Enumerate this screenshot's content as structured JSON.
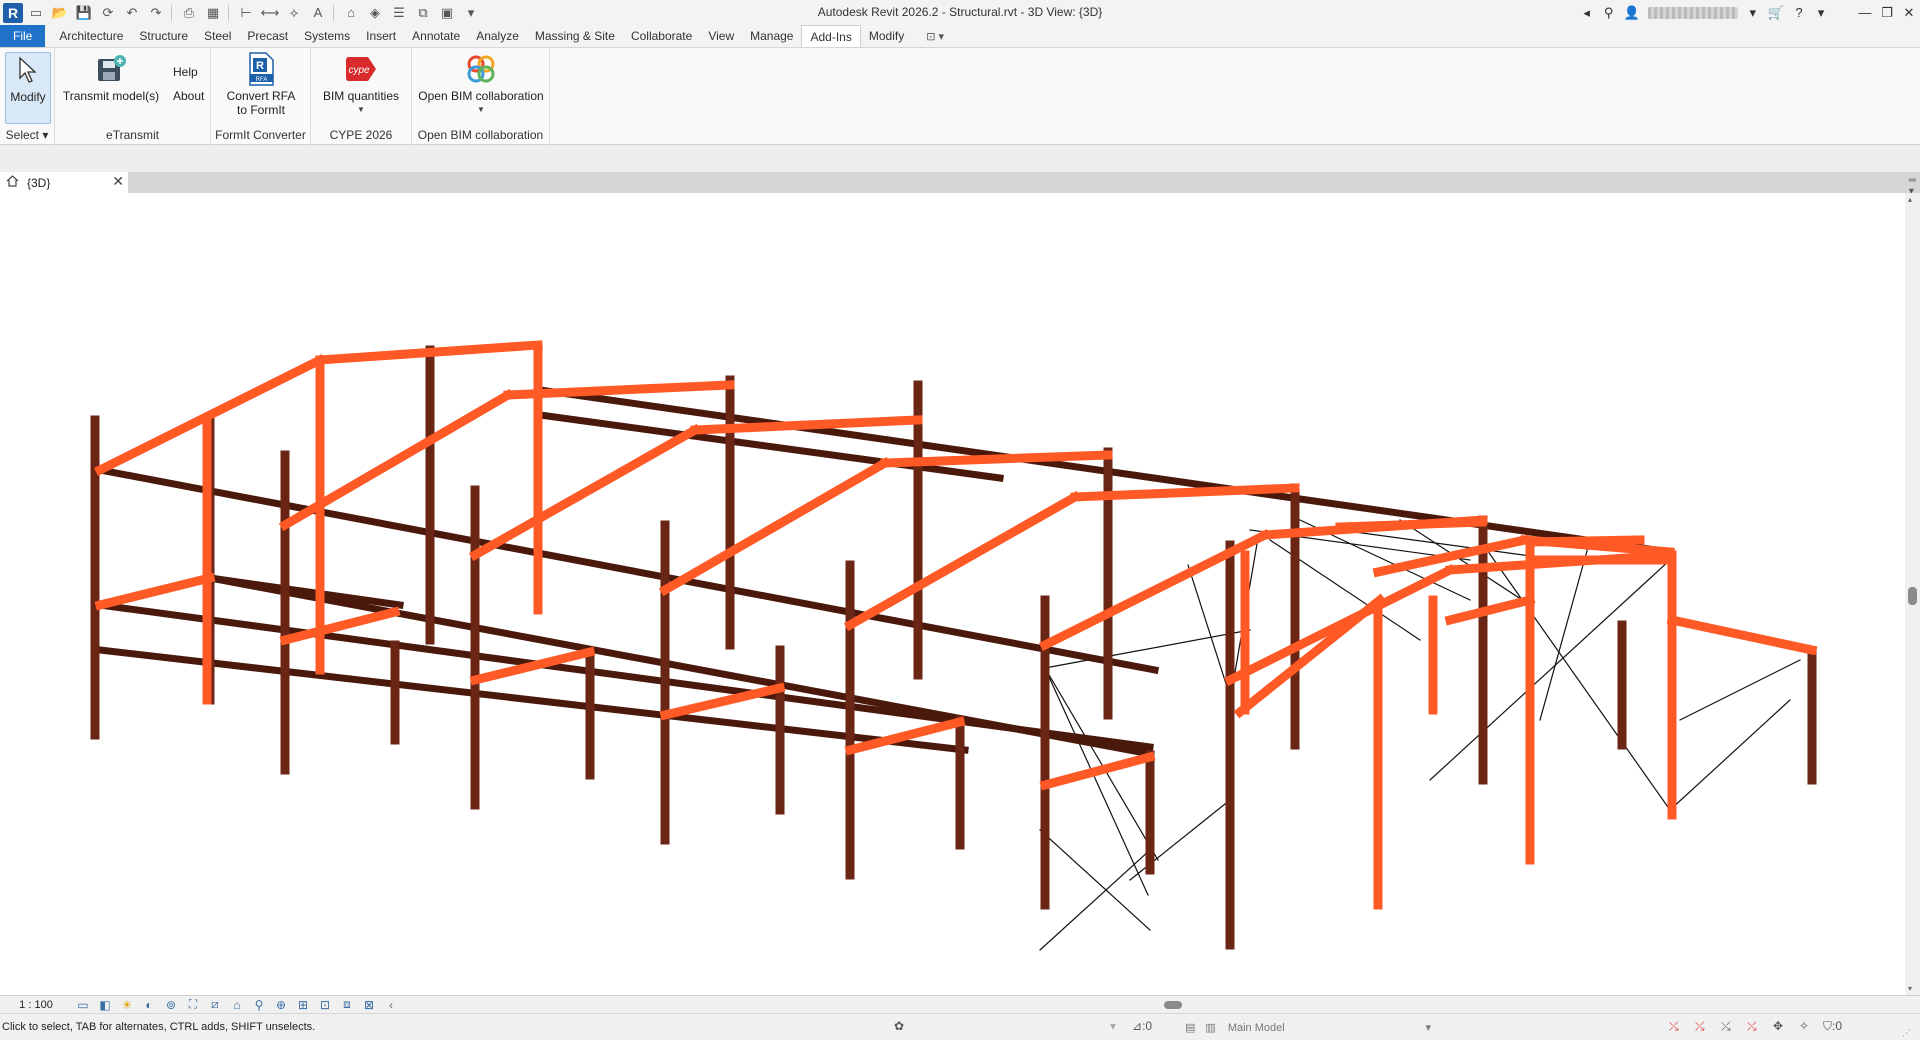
{
  "title_bar": {
    "app_logo": "R",
    "window_title": "Autodesk Revit 2026.2 - Structural.rvt - 3D View: {3D}",
    "qat_icons": [
      "new-icon",
      "open-icon",
      "save-icon",
      "sync-icon",
      "undo-icon",
      "redo-icon",
      "print-icon",
      "schedule-icon",
      "measure-icon",
      "dimension-icon",
      "tag-icon",
      "text-icon",
      "3d-view-icon",
      "section-icon",
      "thin-lines-icon",
      "close-hidden-icon",
      "switch-windows-icon",
      "customize-icon"
    ],
    "right_icons": [
      "search-icon",
      "binoculars-icon",
      "user-icon",
      "cart-icon",
      "help-icon",
      "minimize-icon",
      "restore-icon",
      "close-icon"
    ]
  },
  "ribbon_tabs": [
    "File",
    "Architecture",
    "Structure",
    "Steel",
    "Precast",
    "Systems",
    "Insert",
    "Annotate",
    "Analyze",
    "Massing & Site",
    "Collaborate",
    "View",
    "Manage",
    "Add-Ins",
    "Modify"
  ],
  "active_tab": "Add-Ins",
  "ribbon": {
    "select_panel": {
      "button": "Modify",
      "title": "Select"
    },
    "etransmit_panel": {
      "transmit": "Transmit model(s)",
      "help": "Help",
      "about": "About",
      "title": "eTransmit"
    },
    "formit_panel": {
      "convert_line1": "Convert RFA",
      "convert_line2": "to FormIt",
      "title": "FormIt Converter"
    },
    "cype_panel": {
      "button": "BIM quantities",
      "title": "CYPE 2026"
    },
    "openbim_panel": {
      "button": "Open BIM collaboration",
      "title": "Open BIM collaboration"
    }
  },
  "view_tab": {
    "label": "{3D}"
  },
  "view_control": {
    "scale": "1 : 100"
  },
  "status": {
    "text": "Click to select, TAB for alternates, CTRL adds, SHIFT unselects.",
    "workset_count": ":0",
    "model": "Main Model",
    "filter_count": ":0"
  },
  "colors": {
    "beam": "#ff5a26",
    "column": "#6a2514",
    "accent": "#1f72c8"
  }
}
